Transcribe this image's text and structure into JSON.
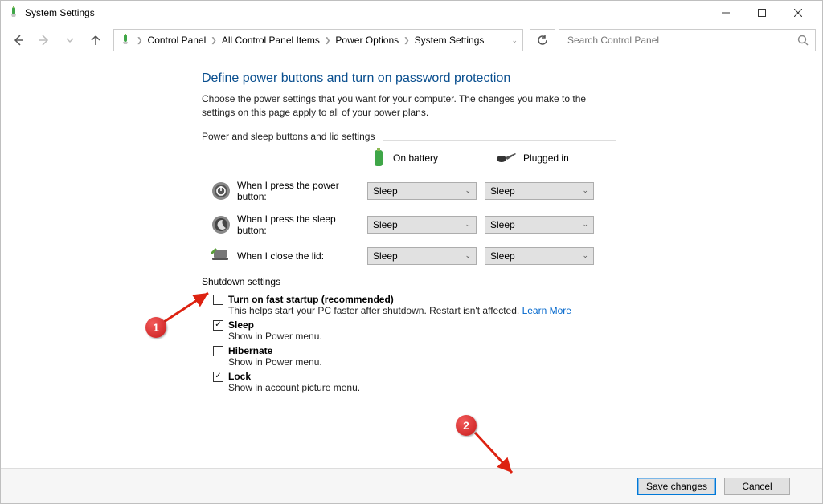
{
  "window": {
    "title": "System Settings"
  },
  "breadcrumb": {
    "items": [
      "Control Panel",
      "All Control Panel Items",
      "Power Options",
      "System Settings"
    ]
  },
  "search": {
    "placeholder": "Search Control Panel"
  },
  "page": {
    "heading": "Define power buttons and turn on password protection",
    "subtext": "Choose the power settings that you want for your computer. The changes you make to the settings on this page apply to all of your power plans.",
    "group_label": "Power and sleep buttons and lid settings",
    "col_battery": "On battery",
    "col_plugged": "Plugged in",
    "rows": [
      {
        "label": "When I press the power button:",
        "battery": "Sleep",
        "plugged": "Sleep"
      },
      {
        "label": "When I press the sleep button:",
        "battery": "Sleep",
        "plugged": "Sleep"
      },
      {
        "label": "When I close the lid:",
        "battery": "Sleep",
        "plugged": "Sleep"
      }
    ],
    "shutdown_label": "Shutdown settings",
    "shutdown": [
      {
        "checked": false,
        "title": "Turn on fast startup (recommended)",
        "desc": "This helps start your PC faster after shutdown. Restart isn't affected. ",
        "link": "Learn More"
      },
      {
        "checked": true,
        "title": "Sleep",
        "desc": "Show in Power menu."
      },
      {
        "checked": false,
        "title": "Hibernate",
        "desc": "Show in Power menu."
      },
      {
        "checked": true,
        "title": "Lock",
        "desc": "Show in account picture menu."
      }
    ]
  },
  "buttons": {
    "save": "Save changes",
    "cancel": "Cancel"
  },
  "annotations": {
    "one": "1",
    "two": "2"
  }
}
